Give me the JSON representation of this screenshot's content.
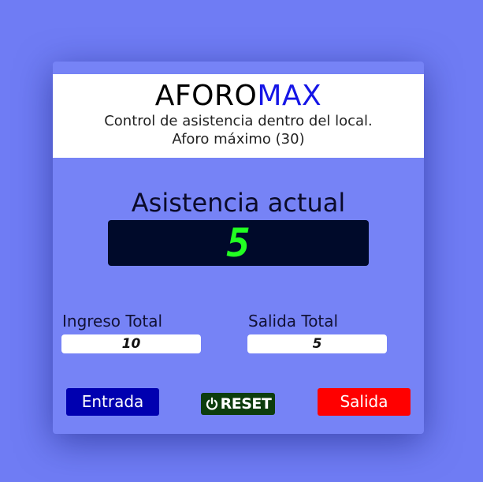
{
  "header": {
    "brand_part1": "AFORO",
    "brand_part2": "MAX",
    "subtitle": "Control de asistencia dentro del local.",
    "capacity_text": "Aforo máximo (30)"
  },
  "attendance": {
    "label": "Asistencia actual",
    "value": "5"
  },
  "counters": {
    "ingreso_label": "Ingreso Total",
    "ingreso_value": "10",
    "salida_label": "Salida Total",
    "salida_value": "5"
  },
  "buttons": {
    "entrada_label": "Entrada",
    "reset_label": "RESET",
    "reset_icon": "power-icon",
    "salida_label": "Salida"
  },
  "colors": {
    "background": "#6f7cf4",
    "card": "#7683f6",
    "brand_accent": "#1515e6",
    "display_bg": "#000a2a",
    "display_digits": "#22ff22",
    "entrada": "#0000b0",
    "reset": "#0d3d0d",
    "salida": "#ff0000"
  }
}
